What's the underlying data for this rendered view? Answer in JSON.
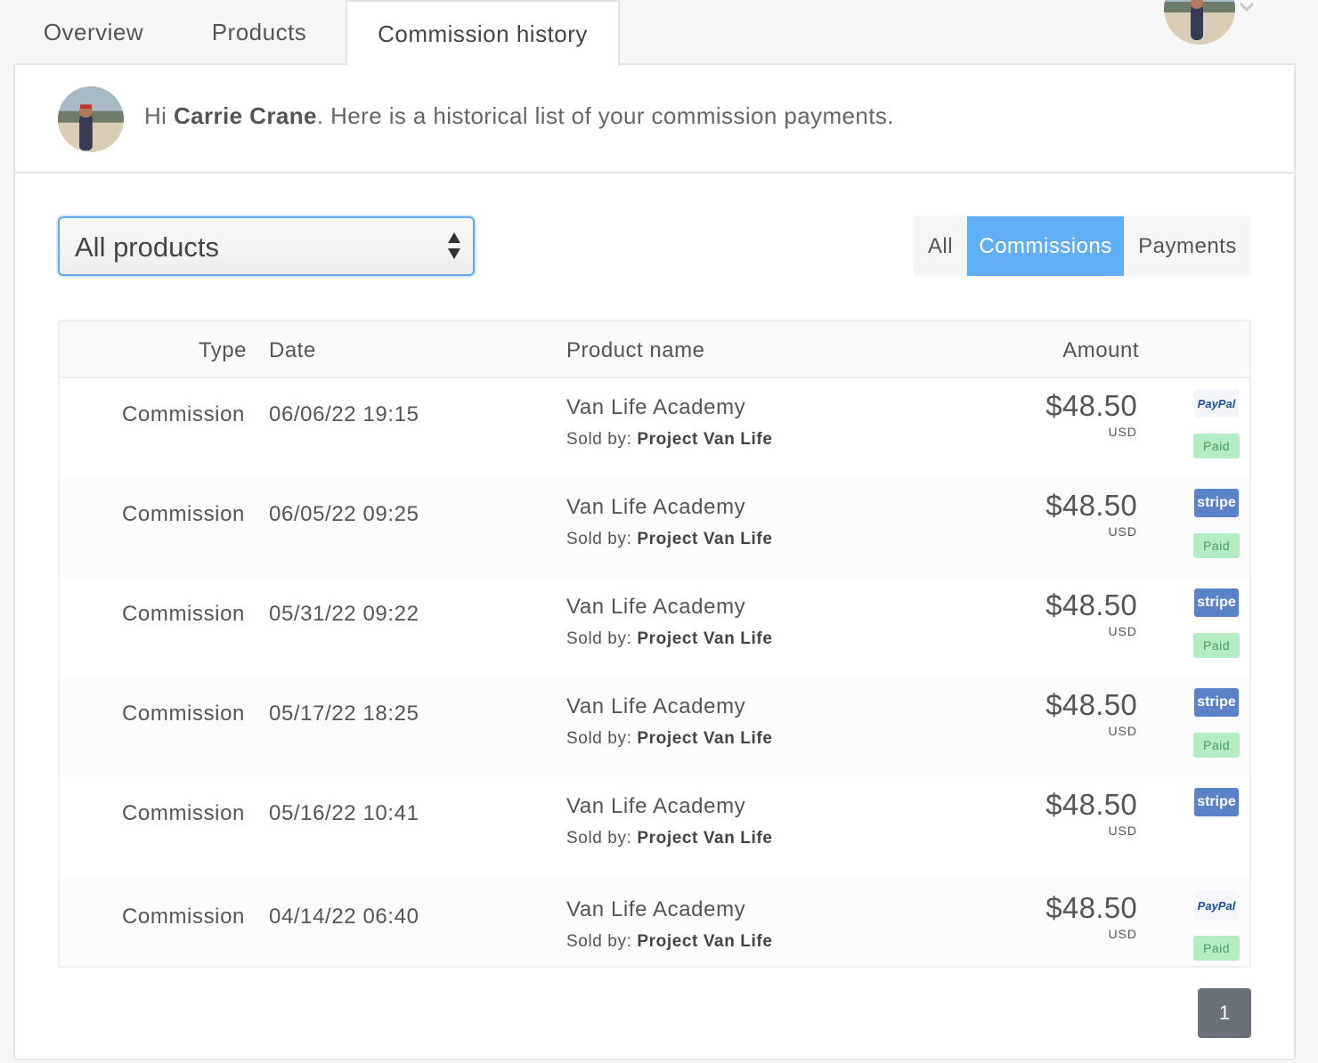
{
  "tabs": [
    {
      "label": "Overview"
    },
    {
      "label": "Products"
    },
    {
      "label": "Commission history",
      "active": true
    }
  ],
  "user": {
    "greeting_prefix": "Hi ",
    "name": "Carrie Crane",
    "greeting_suffix": ". Here is a historical list of your commission payments."
  },
  "filter": {
    "product_select": "All products",
    "segments": [
      {
        "label": "All",
        "active": false
      },
      {
        "label": "Commissions",
        "active": true
      },
      {
        "label": "Payments",
        "active": false
      }
    ]
  },
  "table": {
    "headers": {
      "type": "Type",
      "date": "Date",
      "product": "Product name",
      "amount": "Amount"
    },
    "sold_by_label": "Sold by:",
    "rows": [
      {
        "type": "Commission",
        "date": "06/06/22 19:15",
        "product": "Van Life Academy",
        "seller": "Project Van Life",
        "amount": "$48.50",
        "currency": "USD",
        "method": "PayPal",
        "status": "Paid"
      },
      {
        "type": "Commission",
        "date": "06/05/22 09:25",
        "product": "Van Life Academy",
        "seller": "Project Van Life",
        "amount": "$48.50",
        "currency": "USD",
        "method": "stripe",
        "status": "Paid"
      },
      {
        "type": "Commission",
        "date": "05/31/22 09:22",
        "product": "Van Life Academy",
        "seller": "Project Van Life",
        "amount": "$48.50",
        "currency": "USD",
        "method": "stripe",
        "status": "Paid"
      },
      {
        "type": "Commission",
        "date": "05/17/22 18:25",
        "product": "Van Life Academy",
        "seller": "Project Van Life",
        "amount": "$48.50",
        "currency": "USD",
        "method": "stripe",
        "status": "Paid"
      },
      {
        "type": "Commission",
        "date": "05/16/22 10:41",
        "product": "Van Life Academy",
        "seller": "Project Van Life",
        "amount": "$48.50",
        "currency": "USD",
        "method": "stripe",
        "status": ""
      },
      {
        "type": "Commission",
        "date": "04/14/22 06:40",
        "product": "Van Life Academy",
        "seller": "Project Van Life",
        "amount": "$48.50",
        "currency": "USD",
        "method": "PayPal",
        "status": "Paid"
      }
    ]
  },
  "pagination": {
    "current": "1"
  },
  "colors": {
    "accent": "#62aef4",
    "stripe": "#5a82c9",
    "paypal": "#1f4f9b",
    "paid_bg": "#b4ecc6",
    "paid_text": "#4d9c68",
    "pager": "#6b7179"
  }
}
